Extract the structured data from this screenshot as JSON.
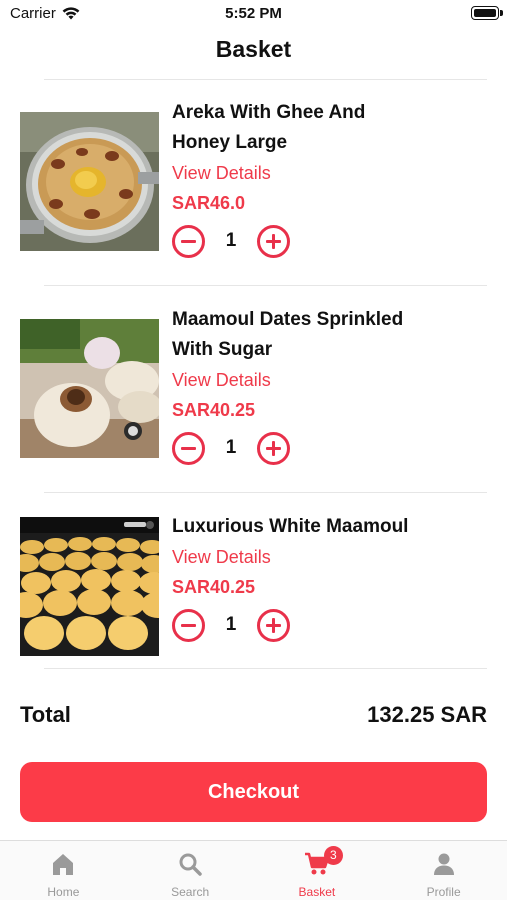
{
  "status_bar": {
    "carrier": "Carrier",
    "time": "5:52 PM"
  },
  "nav": {
    "title": "Basket"
  },
  "items": [
    {
      "name_line1": "Areka With Ghee And",
      "name_line2": "Honey Large",
      "view_details": "View Details",
      "price": "SAR46.0",
      "quantity": "1",
      "image_icon": "areka-dish-photo"
    },
    {
      "name_line1": "Maamoul Dates Sprinkled",
      "name_line2": "With Sugar",
      "view_details": "View Details",
      "price": "SAR40.25",
      "quantity": "1",
      "image_icon": "maamoul-dates-photo"
    },
    {
      "name_line1": "Luxurious White Maamoul",
      "view_details": "View Details",
      "price": "SAR40.25",
      "quantity": "1",
      "image_icon": "white-maamoul-photo"
    }
  ],
  "total": {
    "label": "Total",
    "value": "132.25 SAR"
  },
  "checkout": {
    "label": "Checkout"
  },
  "tabs": [
    {
      "label": "Home",
      "icon": "home-icon"
    },
    {
      "label": "Search",
      "icon": "search-icon"
    },
    {
      "label": "Basket",
      "icon": "cart-icon",
      "badge": "3",
      "active": true
    },
    {
      "label": "Profile",
      "icon": "profile-icon"
    }
  ],
  "colors": {
    "accent": "#ef3a4a",
    "checkout_bg": "#fc3b48",
    "inactive_tab": "#999999"
  }
}
